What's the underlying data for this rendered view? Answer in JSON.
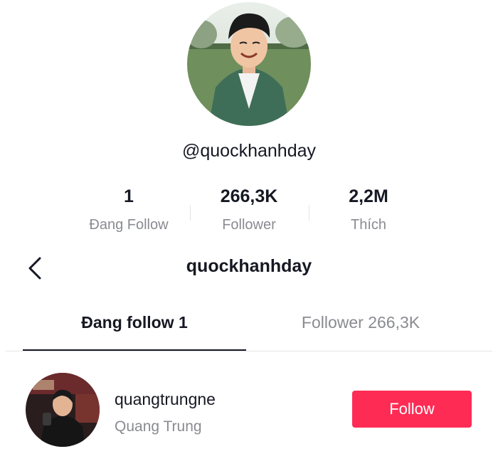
{
  "profile": {
    "handle": "@quockhanhday",
    "stats": [
      {
        "value": "1",
        "label": "Đang Follow"
      },
      {
        "value": "266,3K",
        "label": "Follower"
      },
      {
        "value": "2,2M",
        "label": "Thích"
      }
    ]
  },
  "nav": {
    "title": "quockhanhday",
    "back_icon": "chevron-left-icon"
  },
  "tabs": [
    {
      "label": "Đang follow 1",
      "active": true
    },
    {
      "label": "Follower 266,3K",
      "active": false
    }
  ],
  "following": [
    {
      "username": "quangtrungne",
      "display_name": "Quang Trung",
      "button_label": "Follow"
    }
  ],
  "colors": {
    "accent": "#fe2c55",
    "text_primary": "#161823",
    "text_secondary": "#8a8b91"
  }
}
